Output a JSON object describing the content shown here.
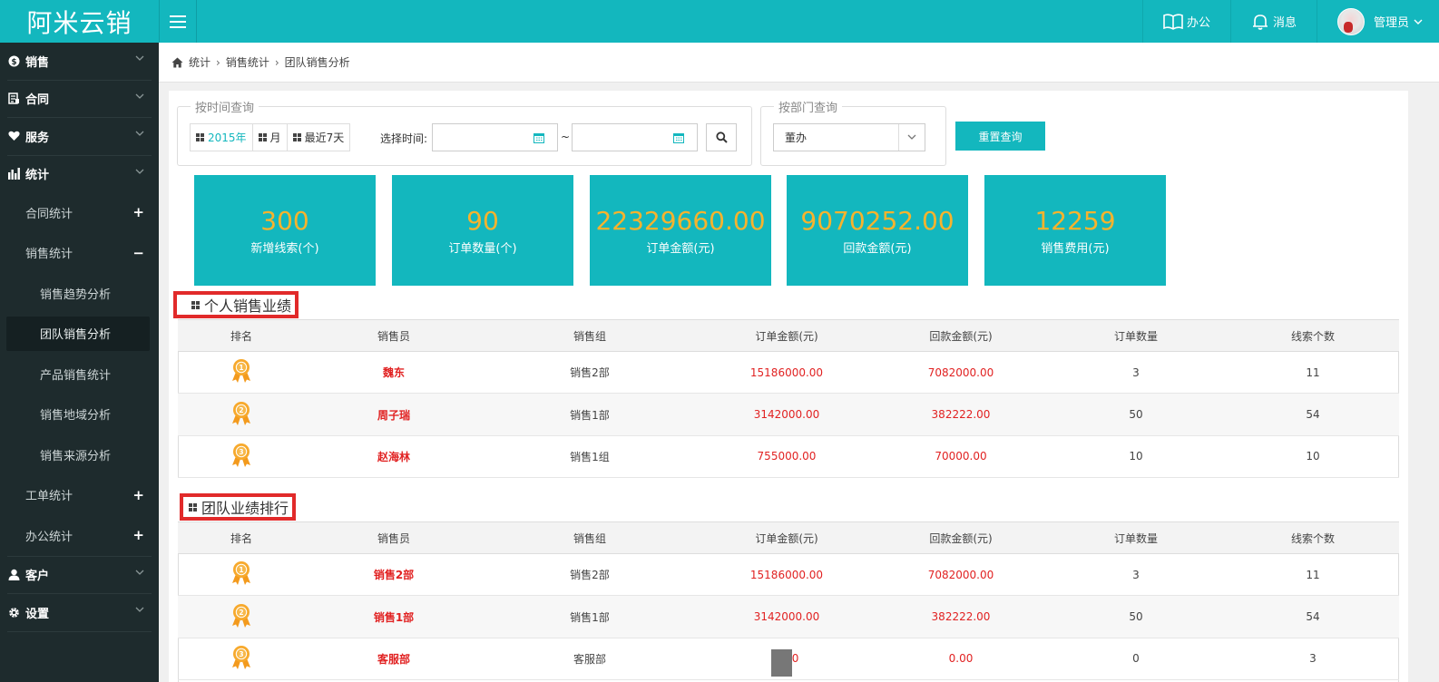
{
  "app": {
    "logo_text": "阿米云销"
  },
  "topbar": {
    "office_label": "办公",
    "messages_label": "消息",
    "user_label": "管理员"
  },
  "sidebar": {
    "sales": "销售",
    "contract": "合同",
    "service": "服务",
    "stats": "统计",
    "contract_stats": "合同统计",
    "sales_stats": "销售统计",
    "sales_trend": "销售趋势分析",
    "team_sales": "团队销售分析",
    "product_sales": "产品销售统计",
    "sales_region": "销售地域分析",
    "sales_source": "销售来源分析",
    "workorder_stats": "工单统计",
    "office_stats": "办公统计",
    "customer": "客户",
    "settings": "设置",
    "plus": "+",
    "minus": "−"
  },
  "breadcrumb": {
    "home": "统计",
    "level2": "销售统计",
    "level3": "团队销售分析"
  },
  "query": {
    "time_legend": "按时间查询",
    "year_label": "2015年",
    "month_label": "月",
    "week_label": "最近7天",
    "select_time_label": "选择时间:",
    "tilde": "~",
    "dept_legend": "按部门查询",
    "dept_value": "董办",
    "reset_label": "重置查询"
  },
  "stats": [
    {
      "value": "300",
      "label": "新增线索(个)"
    },
    {
      "value": "90",
      "label": "订单数量(个)"
    },
    {
      "value": "22329660.00",
      "label": "订单金额(元)"
    },
    {
      "value": "9070252.00",
      "label": "回款金额(元)"
    },
    {
      "value": "12259",
      "label": "销售费用(元)"
    }
  ],
  "personal": {
    "title": "个人销售业绩",
    "headers": [
      "排名",
      "销售员",
      "销售组",
      "订单金额(元)",
      "回款金额(元)",
      "订单数量",
      "线索个数"
    ],
    "rows": [
      {
        "rank": "1",
        "name": "魏东",
        "group": "销售2部",
        "order_amount": "15186000.00",
        "payment": "7082000.00",
        "orders": "3",
        "leads": "11"
      },
      {
        "rank": "2",
        "name": "周子瑞",
        "group": "销售1部",
        "order_amount": "3142000.00",
        "payment": "382222.00",
        "orders": "50",
        "leads": "54"
      },
      {
        "rank": "3",
        "name": "赵海林",
        "group": "销售1组",
        "order_amount": "755000.00",
        "payment": "70000.00",
        "orders": "10",
        "leads": "10"
      }
    ]
  },
  "team": {
    "title": "团队业绩排行",
    "headers": [
      "排名",
      "销售员",
      "销售组",
      "订单金额(元)",
      "回款金额(元)",
      "订单数量",
      "线索个数"
    ],
    "rows": [
      {
        "rank": "1",
        "name": "销售2部",
        "group": "销售2部",
        "order_amount": "15186000.00",
        "payment": "7082000.00",
        "orders": "3",
        "leads": "11"
      },
      {
        "rank": "2",
        "name": "销售1部",
        "group": "销售1部",
        "order_amount": "3142000.00",
        "payment": "382222.00",
        "orders": "50",
        "leads": "54"
      },
      {
        "rank": "3",
        "name": "客服部",
        "group": "客服部",
        "order_amount": "0.00",
        "payment": "0.00",
        "orders": "0",
        "leads": "3"
      }
    ]
  },
  "colors": {
    "accent": "#13b7be",
    "sidebar": "#1e2b2d",
    "stat_number": "#f7b32d",
    "highlight": "#e12a2a"
  }
}
